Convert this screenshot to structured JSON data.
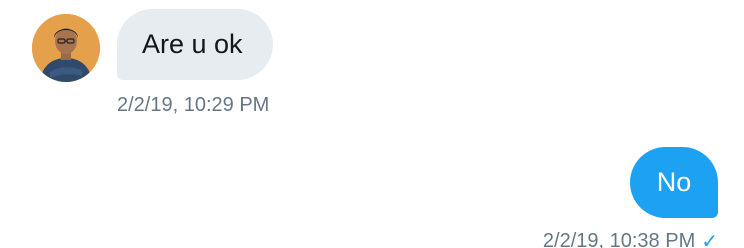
{
  "messages": [
    {
      "direction": "incoming",
      "text": "Are u ok",
      "timestamp": "2/2/19, 10:29 PM",
      "avatar": "user-avatar-photo"
    },
    {
      "direction": "outgoing",
      "text": "No",
      "timestamp": "2/2/19, 10:38 PM",
      "status_icon": "check-icon"
    }
  ],
  "colors": {
    "incoming_bubble": "#e6ecf0",
    "outgoing_bubble": "#1da1f2",
    "timestamp_text": "#657786",
    "accent": "#1da1f2"
  }
}
